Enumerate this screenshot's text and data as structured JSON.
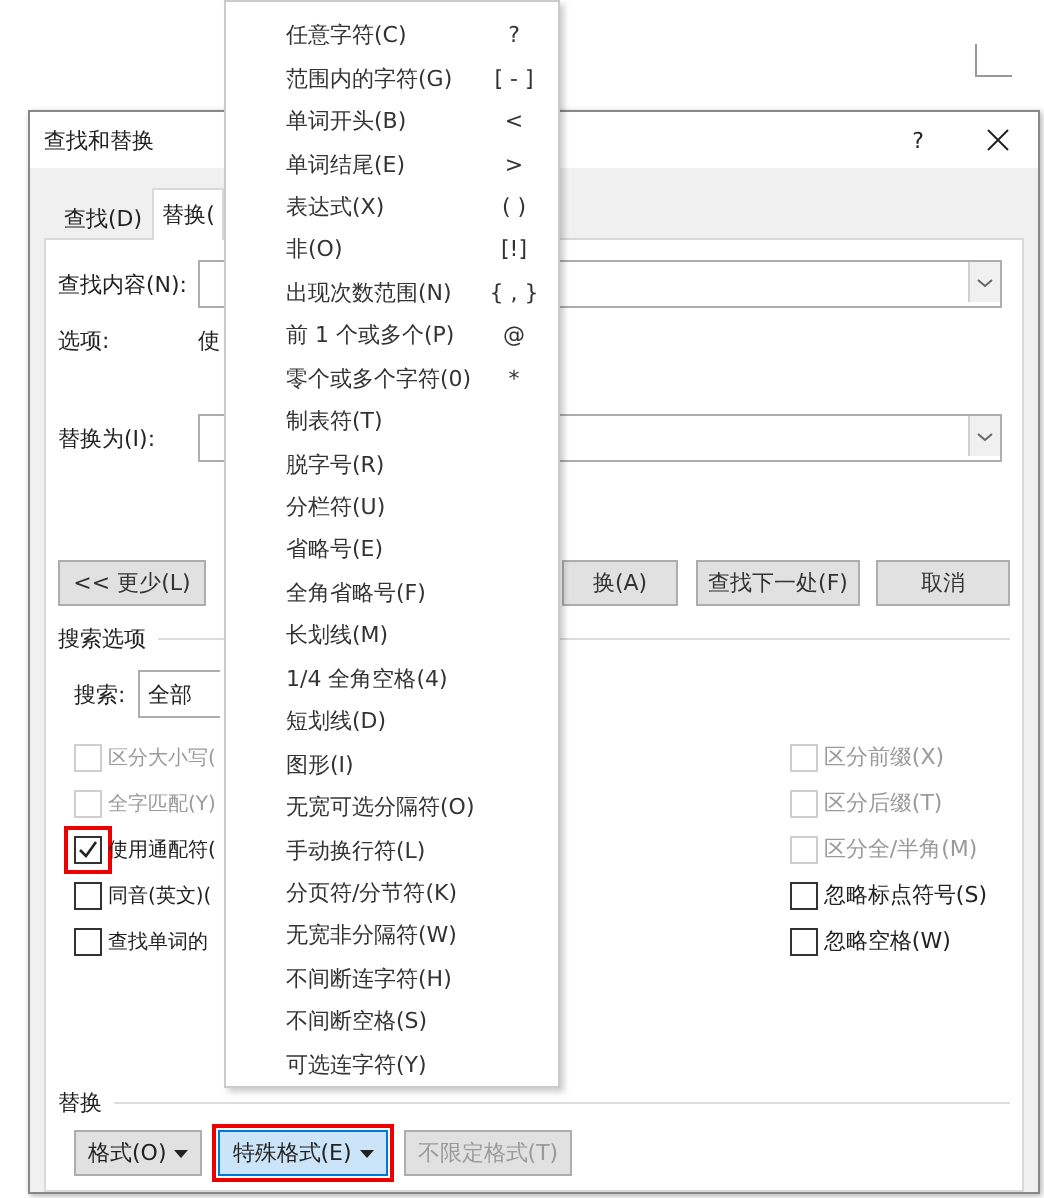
{
  "dialog": {
    "title": "查找和替换",
    "help": "?",
    "tabs": [
      {
        "label": "查找(D)",
        "selected": false
      },
      {
        "label": "替换(",
        "selected": true
      }
    ],
    "find": {
      "label": "查找内容(N):"
    },
    "options": {
      "label": "选项:",
      "value": "使"
    },
    "replace": {
      "label": "替换为(I):"
    },
    "buttons": [
      {
        "label": "<< 更少(L)"
      },
      {
        "label": "换(A)"
      },
      {
        "label": "查找下一处(F)"
      },
      {
        "label": "取消"
      }
    ],
    "search_options": {
      "title": "搜索选项",
      "search_label": "搜索:",
      "search_value": "全部",
      "left_checks": [
        {
          "label": "区分大小写(",
          "checked": false,
          "disabled": true,
          "highlighted": false
        },
        {
          "label": "全字匹配(Y)",
          "checked": false,
          "disabled": true,
          "highlighted": false
        },
        {
          "label": "使用通配符(",
          "checked": true,
          "disabled": false,
          "highlighted": true
        },
        {
          "label": "同音(英文)(",
          "checked": false,
          "disabled": false,
          "highlighted": false
        },
        {
          "label": "查找单词的",
          "checked": false,
          "disabled": false,
          "highlighted": false
        }
      ],
      "right_checks": [
        {
          "label": "区分前缀(X)",
          "checked": false,
          "disabled": true,
          "highlighted": false
        },
        {
          "label": "区分后缀(T)",
          "checked": false,
          "disabled": true,
          "highlighted": false
        },
        {
          "label": "区分全/半角(M)",
          "checked": false,
          "disabled": true,
          "highlighted": false
        },
        {
          "label": "忽略标点符号(S)",
          "checked": false,
          "disabled": false,
          "highlighted": false
        },
        {
          "label": "忽略空格(W)",
          "checked": false,
          "disabled": false,
          "highlighted": false
        }
      ]
    },
    "replace_section": {
      "title": "替换",
      "buttons": [
        {
          "label": "格式(O)",
          "caret": true,
          "pressed": false,
          "disabled": false,
          "highlighted": false
        },
        {
          "label": "特殊格式(E)",
          "caret": true,
          "pressed": true,
          "disabled": false,
          "highlighted": true
        },
        {
          "label": "不限定格式(T)",
          "caret": false,
          "pressed": false,
          "disabled": true,
          "highlighted": false
        }
      ]
    }
  },
  "menu": {
    "items": [
      {
        "label": "任意字符(C)",
        "shortcut": "?"
      },
      {
        "label": "范围内的字符(G)",
        "shortcut": "[ - ]"
      },
      {
        "label": "单词开头(B)",
        "shortcut": "<"
      },
      {
        "label": "单词结尾(E)",
        "shortcut": ">"
      },
      {
        "label": "表达式(X)",
        "shortcut": "( )"
      },
      {
        "label": "非(O)",
        "shortcut": "[!]"
      },
      {
        "label": "出现次数范围(N)",
        "shortcut": "{ , }"
      },
      {
        "label": "前 1 个或多个(P)",
        "shortcut": "@"
      },
      {
        "label": "零个或多个字符(0)",
        "shortcut": "*"
      },
      {
        "label": "制表符(T)"
      },
      {
        "label": "脱字号(R)"
      },
      {
        "label": "分栏符(U)"
      },
      {
        "label": "省略号(E)"
      },
      {
        "label": "全角省略号(F)"
      },
      {
        "label": "长划线(M)"
      },
      {
        "label": "1/4 全角空格(4)"
      },
      {
        "label": "短划线(D)"
      },
      {
        "label": "图形(I)"
      },
      {
        "label": "无宽可选分隔符(O)"
      },
      {
        "label": "手动换行符(L)"
      },
      {
        "label": "分页符/分节符(K)"
      },
      {
        "label": "无宽非分隔符(W)"
      },
      {
        "label": "不间断连字符(H)"
      },
      {
        "label": "不间断空格(S)"
      },
      {
        "label": "可选连字符(Y)"
      }
    ]
  }
}
